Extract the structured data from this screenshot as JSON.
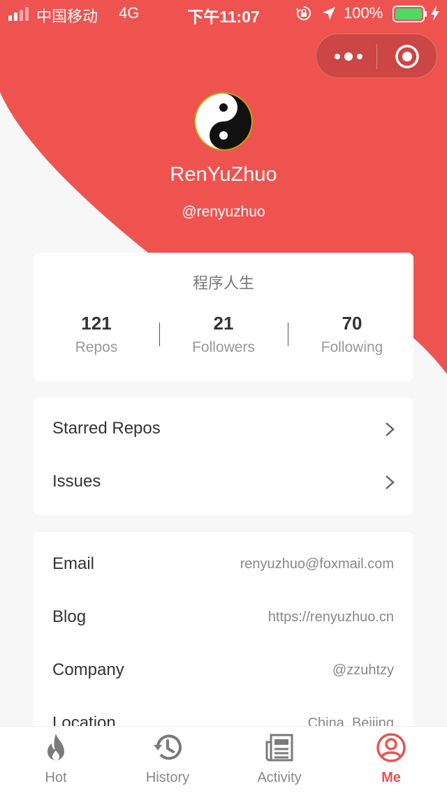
{
  "colors": {
    "accent": "#ef5350",
    "active_tab": "#e85452",
    "background": "#f7f7f7",
    "card": "#ffffff"
  },
  "status_bar": {
    "carrier": "中国移动",
    "network": "4G",
    "time": "下午11:07",
    "battery_percent": "100%",
    "icons": [
      "signal-icon",
      "orientation-lock-icon",
      "location-icon",
      "battery-icon",
      "charging-icon"
    ]
  },
  "capsule": {
    "icons": [
      "more-dots-icon",
      "close-target-icon"
    ]
  },
  "profile": {
    "name": "RenYuZhuo",
    "login": "@renyuzhuo",
    "avatar_icon": "yin-yang-avatar"
  },
  "stats_card": {
    "bio": "程序人生",
    "items": [
      {
        "value": "121",
        "label": "Repos"
      },
      {
        "value": "21",
        "label": "Followers"
      },
      {
        "value": "70",
        "label": "Following"
      }
    ]
  },
  "links": [
    {
      "label": "Starred Repos"
    },
    {
      "label": "Issues"
    }
  ],
  "info": [
    {
      "label": "Email",
      "value": "renyuzhuo@foxmail.com"
    },
    {
      "label": "Blog",
      "value": "https://renyuzhuo.cn"
    },
    {
      "label": "Company",
      "value": "@zzuhtzy"
    },
    {
      "label": "Location",
      "value": "China, Beijing"
    }
  ],
  "tabs": [
    {
      "label": "Hot",
      "icon": "flame-icon",
      "active": false
    },
    {
      "label": "History",
      "icon": "history-icon",
      "active": false
    },
    {
      "label": "Activity",
      "icon": "news-icon",
      "active": false
    },
    {
      "label": "Me",
      "icon": "user-circle-icon",
      "active": true
    }
  ]
}
